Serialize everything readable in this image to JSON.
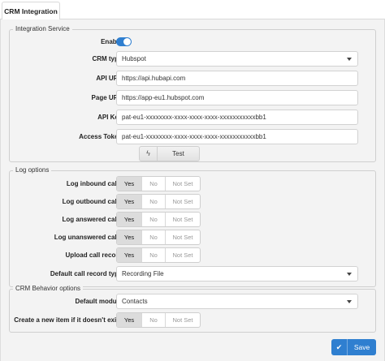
{
  "tab": {
    "label": "CRM Integration"
  },
  "integration": {
    "legend": "Integration Service",
    "enable_label": "Enable:",
    "enable_on": true,
    "crm_type": {
      "label": "CRM type:",
      "value": "Hubspot"
    },
    "api_url": {
      "label": "API URL:",
      "value": "https://api.hubapi.com"
    },
    "page_url": {
      "label": "Page URL:",
      "value": "https://app-eu1.hubspot.com"
    },
    "api_key": {
      "label": "API Key:",
      "value": "pat-eu1-xxxxxxxx-xxxx-xxxx-xxxx-xxxxxxxxxxxbb1"
    },
    "access_token": {
      "label": "Access Token:",
      "value": "pat-eu1-xxxxxxxx-xxxx-xxxx-xxxx-xxxxxxxxxxxbb1"
    },
    "test_button": {
      "icon": "bolt-icon",
      "label": "Test"
    }
  },
  "log": {
    "legend": "Log options",
    "options": {
      "yes": "Yes",
      "no": "No",
      "notset": "Not Set"
    },
    "inbound": {
      "label": "Log inbound calls:",
      "selected": "yes"
    },
    "outbound": {
      "label": "Log outbound calls:",
      "selected": "yes"
    },
    "answered": {
      "label": "Log answered calls:",
      "selected": "yes"
    },
    "unanswered": {
      "label": "Log unanswered calls:",
      "selected": "yes"
    },
    "upload": {
      "label": "Upload call record:",
      "selected": "yes"
    },
    "record_type": {
      "label": "Default call record type:",
      "value": "Recording File"
    }
  },
  "behavior": {
    "legend": "CRM Behavior options",
    "module": {
      "label": "Default module:",
      "value": "Contacts"
    },
    "create": {
      "label": "Create a new item if it doesn't exist:",
      "selected": "yes"
    }
  },
  "save_button": {
    "icon": "check-icon",
    "label": "Save"
  },
  "colors": {
    "accent": "#2f7fd0",
    "panel": "#f3f3f3"
  }
}
